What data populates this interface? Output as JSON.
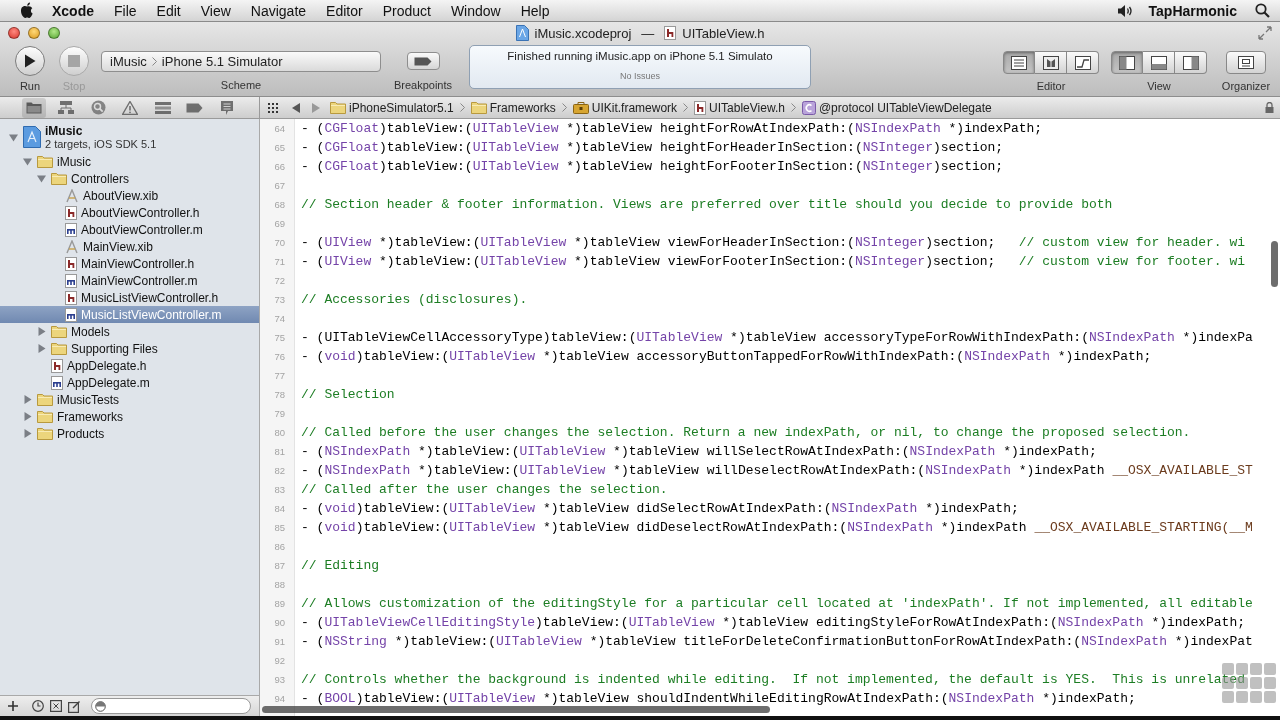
{
  "menu_bar": {
    "app": "Xcode",
    "menus": [
      "File",
      "Edit",
      "View",
      "Navigate",
      "Editor",
      "Product",
      "Window",
      "Help"
    ],
    "user": "TapHarmonic"
  },
  "window": {
    "project_title": "iMusic.xcodeproj",
    "separator": "—",
    "file_title": "UITableView.h"
  },
  "toolbar": {
    "run": {
      "label": "Run"
    },
    "stop": {
      "label": "Stop",
      "disabled": true
    },
    "scheme": {
      "project": "iMusic",
      "destination": "iPhone 5.1 Simulator",
      "label": "Scheme"
    },
    "breakpoints": {
      "label": "Breakpoints"
    },
    "activity": {
      "status": "Finished running iMusic.app on iPhone 5.1 Simulato",
      "issues": "No Issues"
    },
    "editor": {
      "label": "Editor",
      "modes": [
        {
          "kind": "standard",
          "selected": true
        },
        {
          "kind": "assistant",
          "selected": false
        },
        {
          "kind": "version",
          "selected": false
        }
      ]
    },
    "view": {
      "label": "View",
      "panes": [
        {
          "kind": "navigator",
          "selected": true
        },
        {
          "kind": "debug",
          "selected": false
        },
        {
          "kind": "utilities",
          "selected": false
        }
      ]
    },
    "organizer": {
      "label": "Organizer"
    }
  },
  "navigator_tabs": [
    {
      "kind": "project",
      "selected": true
    },
    {
      "kind": "symbol",
      "selected": false
    },
    {
      "kind": "search",
      "selected": false
    },
    {
      "kind": "issue",
      "selected": false
    },
    {
      "kind": "debug",
      "selected": false
    },
    {
      "kind": "breakpoint",
      "selected": false
    },
    {
      "kind": "log",
      "selected": false
    }
  ],
  "jump_bar": [
    {
      "kind": "folder",
      "label": "iPhoneSimulator5.1"
    },
    {
      "kind": "folder",
      "label": "Frameworks"
    },
    {
      "kind": "framework",
      "label": "UIKit.framework"
    },
    {
      "kind": "h",
      "label": "UITableView.h"
    },
    {
      "kind": "protocol",
      "label": "@protocol UITableViewDelegate"
    }
  ],
  "project_tree": [
    {
      "kind": "project",
      "name": "iMusic",
      "subtitle": "2 targets, iOS SDK 5.1",
      "expanded": true,
      "selected": false,
      "children": [
        {
          "kind": "folder",
          "name": "iMusic",
          "expanded": true,
          "selected": false,
          "children": [
            {
              "kind": "folder",
              "name": "Controllers",
              "expanded": true,
              "selected": false,
              "children": [
                {
                  "kind": "xib",
                  "name": "AboutView.xib",
                  "selected": false
                },
                {
                  "kind": "h",
                  "name": "AboutViewController.h",
                  "selected": false
                },
                {
                  "kind": "m",
                  "name": "AboutViewController.m",
                  "selected": false
                },
                {
                  "kind": "xib",
                  "name": "MainView.xib",
                  "selected": false
                },
                {
                  "kind": "h",
                  "name": "MainViewController.h",
                  "selected": false
                },
                {
                  "kind": "m",
                  "name": "MainViewController.m",
                  "selected": false
                },
                {
                  "kind": "h",
                  "name": "MusicListViewController.h",
                  "selected": false
                },
                {
                  "kind": "m",
                  "name": "MusicListViewController.m",
                  "selected": true
                }
              ]
            },
            {
              "kind": "folder",
              "name": "Models",
              "expanded": false,
              "selected": false
            },
            {
              "kind": "folder",
              "name": "Supporting Files",
              "expanded": false,
              "selected": false
            },
            {
              "kind": "h",
              "name": "AppDelegate.h",
              "selected": false
            },
            {
              "kind": "m",
              "name": "AppDelegate.m",
              "selected": false
            }
          ]
        },
        {
          "kind": "folder",
          "name": "iMusicTests",
          "expanded": false,
          "selected": false
        },
        {
          "kind": "folder",
          "name": "Frameworks",
          "expanded": false,
          "selected": false
        },
        {
          "kind": "folder",
          "name": "Products",
          "expanded": false,
          "selected": false
        }
      ]
    }
  ],
  "editor": {
    "lines": [
      {
        "number": "64",
        "code": [
          {
            "kind": "plain",
            "text": "- ("
          },
          {
            "kind": "type",
            "text": "CGFloat"
          },
          {
            "kind": "plain",
            "text": ")tableView:("
          },
          {
            "kind": "type",
            "text": "UITableView"
          },
          {
            "kind": "plain",
            "text": " *)tableView heightForRowAtIndexPath:("
          },
          {
            "kind": "type",
            "text": "NSIndexPath"
          },
          {
            "kind": "plain",
            "text": " *)indexPath;"
          }
        ]
      },
      {
        "number": "65",
        "code": [
          {
            "kind": "plain",
            "text": "- ("
          },
          {
            "kind": "type",
            "text": "CGFloat"
          },
          {
            "kind": "plain",
            "text": ")tableView:("
          },
          {
            "kind": "type",
            "text": "UITableView"
          },
          {
            "kind": "plain",
            "text": " *)tableView heightForHeaderInSection:("
          },
          {
            "kind": "type",
            "text": "NSInteger"
          },
          {
            "kind": "plain",
            "text": ")section;"
          }
        ]
      },
      {
        "number": "66",
        "code": [
          {
            "kind": "plain",
            "text": "- ("
          },
          {
            "kind": "type",
            "text": "CGFloat"
          },
          {
            "kind": "plain",
            "text": ")tableView:("
          },
          {
            "kind": "type",
            "text": "UITableView"
          },
          {
            "kind": "plain",
            "text": " *)tableView heightForFooterInSection:("
          },
          {
            "kind": "type",
            "text": "NSInteger"
          },
          {
            "kind": "plain",
            "text": ")section;"
          }
        ]
      },
      {
        "number": "67"
      },
      {
        "number": "68",
        "code": [
          {
            "kind": "comment",
            "text": "// Section header & footer information. Views are preferred over title should you decide to provide both"
          }
        ]
      },
      {
        "number": "69"
      },
      {
        "number": "70",
        "code": [
          {
            "kind": "plain",
            "text": "- ("
          },
          {
            "kind": "type",
            "text": "UIView"
          },
          {
            "kind": "plain",
            "text": " *)tableView:("
          },
          {
            "kind": "type",
            "text": "UITableView"
          },
          {
            "kind": "plain",
            "text": " *)tableView viewForHeaderInSection:("
          },
          {
            "kind": "type",
            "text": "NSInteger"
          },
          {
            "kind": "plain",
            "text": ")section;   "
          },
          {
            "kind": "comment",
            "text": "// custom view for header. wi"
          }
        ]
      },
      {
        "number": "71",
        "code": [
          {
            "kind": "plain",
            "text": "- ("
          },
          {
            "kind": "type",
            "text": "UIView"
          },
          {
            "kind": "plain",
            "text": " *)tableView:("
          },
          {
            "kind": "type",
            "text": "UITableView"
          },
          {
            "kind": "plain",
            "text": " *)tableView viewForFooterInSection:("
          },
          {
            "kind": "type",
            "text": "NSInteger"
          },
          {
            "kind": "plain",
            "text": ")section;   "
          },
          {
            "kind": "comment",
            "text": "// custom view for footer. wi"
          }
        ]
      },
      {
        "number": "72"
      },
      {
        "number": "73",
        "code": [
          {
            "kind": "comment",
            "text": "// Accessories (disclosures)."
          }
        ]
      },
      {
        "number": "74"
      },
      {
        "number": "75",
        "code": [
          {
            "kind": "plain",
            "text": "- (UITableViewCellAccessoryType)tableView:("
          },
          {
            "kind": "type",
            "text": "UITableView"
          },
          {
            "kind": "plain",
            "text": " *)tableView accessoryTypeForRowWithIndexPath:("
          },
          {
            "kind": "type",
            "text": "NSIndexPath"
          },
          {
            "kind": "plain",
            "text": " *)indexPa"
          }
        ]
      },
      {
        "number": "76",
        "code": [
          {
            "kind": "plain",
            "text": "- ("
          },
          {
            "kind": "type",
            "text": "void"
          },
          {
            "kind": "plain",
            "text": ")tableView:("
          },
          {
            "kind": "type",
            "text": "UITableView"
          },
          {
            "kind": "plain",
            "text": " *)tableView accessoryButtonTappedForRowWithIndexPath:("
          },
          {
            "kind": "type",
            "text": "NSIndexPath"
          },
          {
            "kind": "plain",
            "text": " *)indexPath;"
          }
        ]
      },
      {
        "number": "77"
      },
      {
        "number": "78",
        "code": [
          {
            "kind": "comment",
            "text": "// Selection"
          }
        ]
      },
      {
        "number": "79"
      },
      {
        "number": "80",
        "code": [
          {
            "kind": "comment",
            "text": "// Called before the user changes the selection. Return a new indexPath, or nil, to change the proposed selection."
          }
        ]
      },
      {
        "number": "81",
        "code": [
          {
            "kind": "plain",
            "text": "- ("
          },
          {
            "kind": "type",
            "text": "NSIndexPath"
          },
          {
            "kind": "plain",
            "text": " *)tableView:("
          },
          {
            "kind": "type",
            "text": "UITableView"
          },
          {
            "kind": "plain",
            "text": " *)tableView willSelectRowAtIndexPath:("
          },
          {
            "kind": "type",
            "text": "NSIndexPath"
          },
          {
            "kind": "plain",
            "text": " *)indexPath;"
          }
        ]
      },
      {
        "number": "82",
        "code": [
          {
            "kind": "plain",
            "text": "- ("
          },
          {
            "kind": "type",
            "text": "NSIndexPath"
          },
          {
            "kind": "plain",
            "text": " *)tableView:("
          },
          {
            "kind": "type",
            "text": "UITableView"
          },
          {
            "kind": "plain",
            "text": " *)tableView willDeselectRowAtIndexPath:("
          },
          {
            "kind": "type",
            "text": "NSIndexPath"
          },
          {
            "kind": "plain",
            "text": " *)indexPath "
          },
          {
            "kind": "macro",
            "text": "__OSX_AVAILABLE_ST"
          }
        ]
      },
      {
        "number": "83",
        "code": [
          {
            "kind": "comment",
            "text": "// Called after the user changes the selection."
          }
        ]
      },
      {
        "number": "84",
        "code": [
          {
            "kind": "plain",
            "text": "- ("
          },
          {
            "kind": "type",
            "text": "void"
          },
          {
            "kind": "plain",
            "text": ")tableView:("
          },
          {
            "kind": "type",
            "text": "UITableView"
          },
          {
            "kind": "plain",
            "text": " *)tableView didSelectRowAtIndexPath:("
          },
          {
            "kind": "type",
            "text": "NSIndexPath"
          },
          {
            "kind": "plain",
            "text": " *)indexPath;"
          }
        ]
      },
      {
        "number": "85",
        "code": [
          {
            "kind": "plain",
            "text": "- ("
          },
          {
            "kind": "type",
            "text": "void"
          },
          {
            "kind": "plain",
            "text": ")tableView:("
          },
          {
            "kind": "type",
            "text": "UITableView"
          },
          {
            "kind": "plain",
            "text": " *)tableView didDeselectRowAtIndexPath:("
          },
          {
            "kind": "type",
            "text": "NSIndexPath"
          },
          {
            "kind": "plain",
            "text": " *)indexPath "
          },
          {
            "kind": "macro",
            "text": "__OSX_AVAILABLE_STARTING(__M"
          }
        ]
      },
      {
        "number": "86"
      },
      {
        "number": "87",
        "code": [
          {
            "kind": "comment",
            "text": "// Editing"
          }
        ]
      },
      {
        "number": "88"
      },
      {
        "number": "89",
        "code": [
          {
            "kind": "comment",
            "text": "// Allows customization of the editingStyle for a particular cell located at 'indexPath'. If not implemented, all editable"
          }
        ]
      },
      {
        "number": "90",
        "code": [
          {
            "kind": "plain",
            "text": "- ("
          },
          {
            "kind": "type",
            "text": "UITableViewCellEditingStyle"
          },
          {
            "kind": "plain",
            "text": ")tableView:("
          },
          {
            "kind": "type",
            "text": "UITableView"
          },
          {
            "kind": "plain",
            "text": " *)tableView editingStyleForRowAtIndexPath:("
          },
          {
            "kind": "type",
            "text": "NSIndexPath"
          },
          {
            "kind": "plain",
            "text": " *)indexPath;"
          }
        ]
      },
      {
        "number": "91",
        "code": [
          {
            "kind": "plain",
            "text": "- ("
          },
          {
            "kind": "type",
            "text": "NSString"
          },
          {
            "kind": "plain",
            "text": " *)tableView:("
          },
          {
            "kind": "type",
            "text": "UITableView"
          },
          {
            "kind": "plain",
            "text": " *)tableView titleForDeleteConfirmationButtonForRowAtIndexPath:("
          },
          {
            "kind": "type",
            "text": "NSIndexPath"
          },
          {
            "kind": "plain",
            "text": " *)indexPat"
          }
        ]
      },
      {
        "number": "92"
      },
      {
        "number": "93",
        "code": [
          {
            "kind": "comment",
            "text": "// Controls whether the background is indented while editing.  If not implemented, the default is YES.  This is unrelated"
          }
        ]
      },
      {
        "number": "94",
        "code": [
          {
            "kind": "plain",
            "text": "- ("
          },
          {
            "kind": "type",
            "text": "BOOL"
          },
          {
            "kind": "plain",
            "text": ")tableView:("
          },
          {
            "kind": "type",
            "text": "UITableView"
          },
          {
            "kind": "plain",
            "text": " *)tableView shouldIndentWhileEditingRowAtIndexPath:("
          },
          {
            "kind": "type",
            "text": "NSIndexPath"
          },
          {
            "kind": "plain",
            "text": " *)indexPath;"
          }
        ]
      }
    ]
  }
}
